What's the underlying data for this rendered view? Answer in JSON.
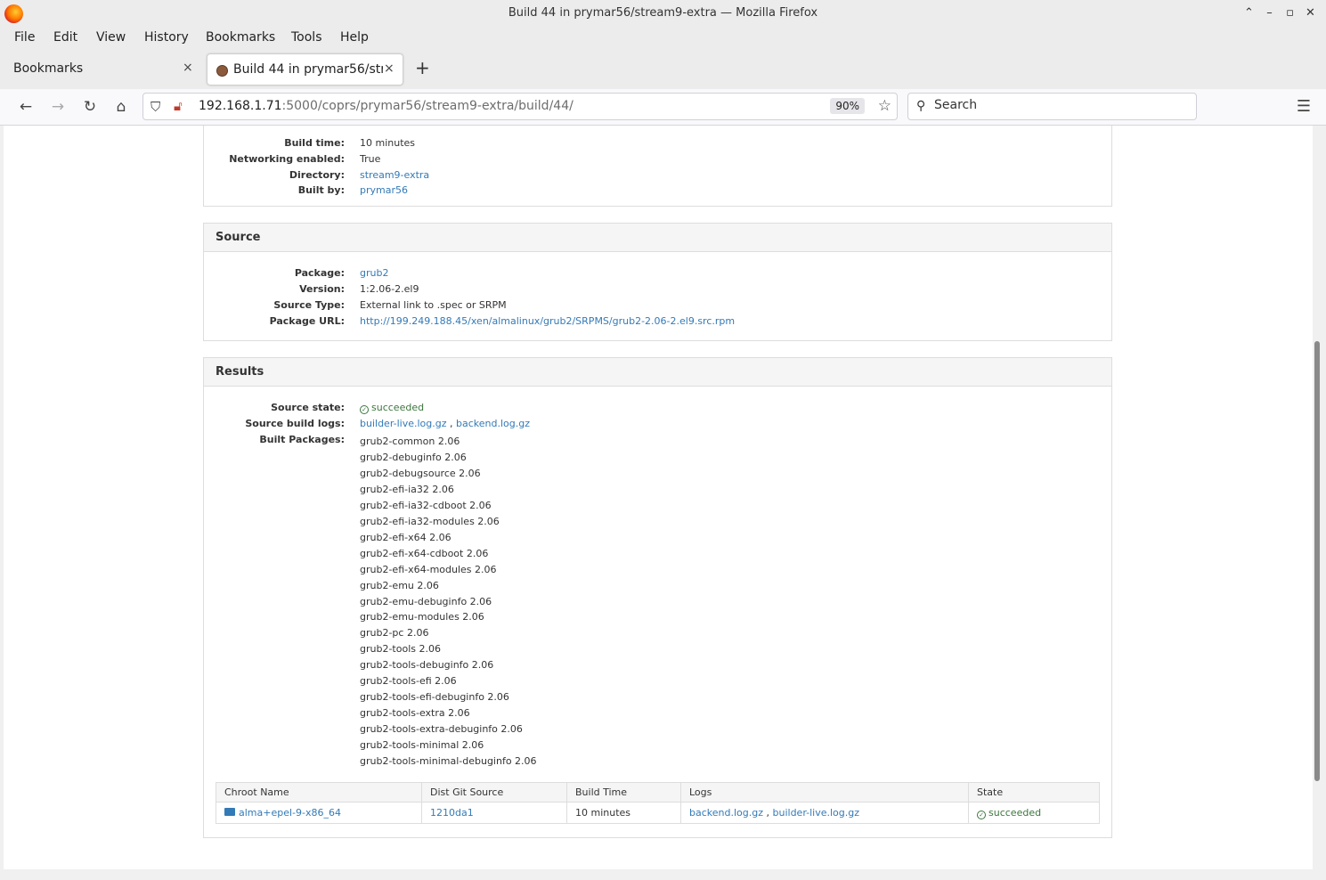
{
  "window": {
    "title": "Build 44 in prymar56/stream9-extra — Mozilla Firefox",
    "controls": [
      "⌃",
      "–",
      "▫",
      "✕"
    ]
  },
  "menu": [
    "File",
    "Edit",
    "View",
    "History",
    "Bookmarks",
    "Tools",
    "Help"
  ],
  "tabs": [
    {
      "label": "Bookmarks",
      "close": "×"
    },
    {
      "label": "Build 44 in prymar56/stream9-extra",
      "close": "×"
    }
  ],
  "newtab": "+",
  "nav": {
    "url_host": "192.168.1.71",
    "url_path": ":5000/coprs/prymar56/stream9-extra/build/44/",
    "zoom": "90%",
    "search_placeholder": "Search"
  },
  "build": {
    "rows": [
      {
        "label": "Build time:",
        "value": "10 minutes",
        "link": false
      },
      {
        "label": "Networking enabled:",
        "value": "True",
        "link": false
      },
      {
        "label": "Directory:",
        "value": "stream9-extra",
        "link": true
      },
      {
        "label": "Built by:",
        "value": "prymar56",
        "link": true
      }
    ]
  },
  "source": {
    "heading": "Source",
    "rows": [
      {
        "label": "Package:",
        "value": "grub2",
        "link": true
      },
      {
        "label": "Version:",
        "value": "1:2.06-2.el9",
        "link": false
      },
      {
        "label": "Source Type:",
        "value": "External link to .spec or SRPM",
        "link": false
      },
      {
        "label": "Package URL:",
        "value": "http://199.249.188.45/xen/almalinux/grub2/SRPMS/grub2-2.06-2.el9.src.rpm",
        "link": true
      }
    ]
  },
  "results": {
    "heading": "Results",
    "source_state_label": "Source state:",
    "source_state": "succeeded",
    "source_logs_label": "Source build logs:",
    "source_logs": [
      "builder-live.log.gz",
      "backend.log.gz"
    ],
    "log_separator": ",",
    "built_packages_label": "Built Packages:",
    "packages": [
      "grub2-common 2.06",
      "grub2-debuginfo 2.06",
      "grub2-debugsource 2.06",
      "grub2-efi-ia32 2.06",
      "grub2-efi-ia32-cdboot 2.06",
      "grub2-efi-ia32-modules 2.06",
      "grub2-efi-x64 2.06",
      "grub2-efi-x64-cdboot 2.06",
      "grub2-efi-x64-modules 2.06",
      "grub2-emu 2.06",
      "grub2-emu-debuginfo 2.06",
      "grub2-emu-modules 2.06",
      "grub2-pc 2.06",
      "grub2-tools 2.06",
      "grub2-tools-debuginfo 2.06",
      "grub2-tools-efi 2.06",
      "grub2-tools-efi-debuginfo 2.06",
      "grub2-tools-extra 2.06",
      "grub2-tools-extra-debuginfo 2.06",
      "grub2-tools-minimal 2.06",
      "grub2-tools-minimal-debuginfo 2.06"
    ],
    "table": {
      "headers": [
        "Chroot Name",
        "Dist Git Source",
        "Build Time",
        "Logs",
        "State"
      ],
      "row": {
        "chroot": "alma+epel-9-x86_64",
        "dist_git": "1210da1",
        "build_time": "10 minutes",
        "logs": [
          "backend.log.gz",
          "builder-live.log.gz"
        ],
        "state": "succeeded"
      }
    }
  },
  "colors": {
    "link": "#337ab7",
    "success": "#3c763d"
  }
}
